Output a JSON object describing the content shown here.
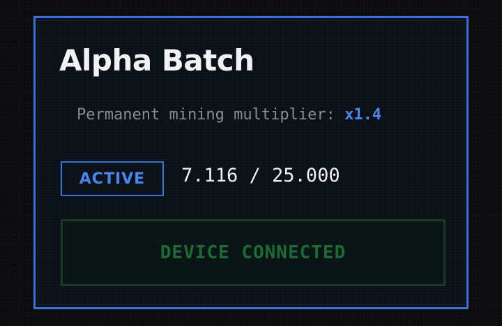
{
  "card": {
    "title": "Alpha Batch",
    "multiplier_label": "Permanent mining multiplier: ",
    "multiplier_value": "x1.4",
    "status": "ACTIVE",
    "progress": "7.116 / 25.000",
    "device_button_label": "DEVICE CONNECTED"
  },
  "colors": {
    "accent": "#3a72d6",
    "accent_text": "#4a86f0",
    "connected_green": "#1d6b34",
    "card_bg": "#0b0f17"
  }
}
